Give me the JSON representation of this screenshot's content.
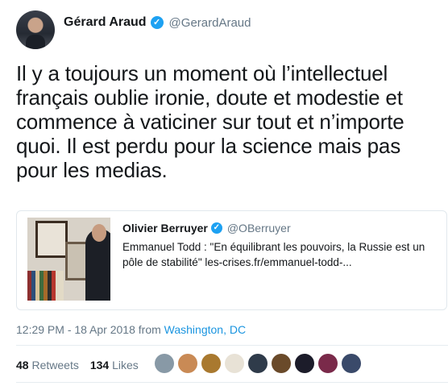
{
  "author": {
    "name": "Gérard Araud",
    "handle": "@GerardAraud",
    "verified_glyph": "✓"
  },
  "tweet_text": "Il y a toujours un moment où l’intellectuel français oublie ironie, doute et modestie et commence à vaticiner sur tout et n’importe quoi. Il est perdu pour la science mais pas pour les medias.",
  "quoted": {
    "name": "Olivier Berruyer",
    "handle": "@OBerruyer",
    "verified_glyph": "✓",
    "text": "Emmanuel Todd : \"En équilibrant les pouvoirs, la Russie est un pôle de stabilité\" les-crises.fr/emmanuel-todd-..."
  },
  "meta": {
    "time": "12:29 PM - 18 Apr 2018 from ",
    "location": "Washington, DC"
  },
  "stats": {
    "retweets_count": "48",
    "retweets_label": "Retweets",
    "likes_count": "134",
    "likes_label": "Likes"
  },
  "liker_avatar_colors": [
    "#8899a6",
    "#c98a55",
    "#a9792f",
    "#e8e2d6",
    "#2f3b4a",
    "#6a4a2a",
    "#1c1c2a",
    "#7a2a4a",
    "#3a4a6a"
  ]
}
